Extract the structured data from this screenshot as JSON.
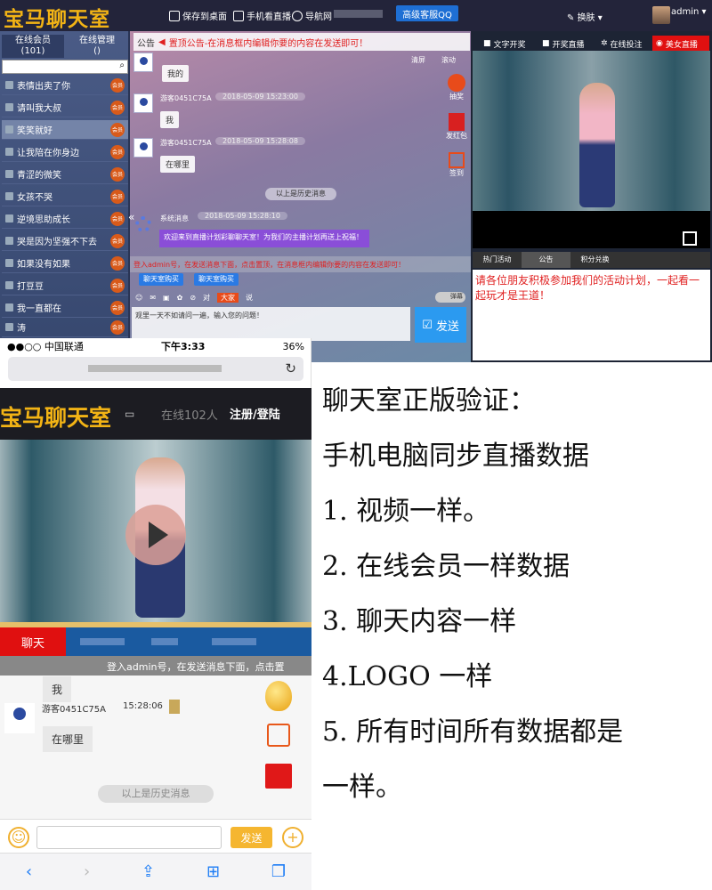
{
  "desktop": {
    "logo": "宝马聊天室",
    "nav": [
      "保存到桌面",
      "手机看直播",
      "导航网"
    ],
    "qq_button": "高级客服QQ",
    "skin": "换肤",
    "admin": "admin",
    "left_tabs": [
      {
        "label": "在线会员",
        "count": "(101)"
      },
      {
        "label": "在线管理",
        "count": "()"
      }
    ],
    "members": [
      "表情出卖了你",
      "请叫我大叔",
      "笑笑就好",
      "让我陪在你身边",
      "青涩的微笑",
      "女孩不哭",
      "逆境思助成长",
      "哭是因为坚强不下去",
      "如果没有如果",
      "打豆豆",
      "我一直都在",
      "涛"
    ],
    "member_badge": "会员",
    "notice_label": "公告",
    "notice": "置顶公告-在消息框内编辑你要的内容在发送即可！",
    "chat_tools": [
      "清屏",
      "滚动"
    ],
    "side_buttons": [
      "抽奖",
      "发红包",
      "签到"
    ],
    "messages": [
      {
        "name": "游客0451C75A",
        "time": "2018-05-09 15:23:00",
        "text": "我的"
      },
      {
        "name": "游客0451C75A",
        "time": "2018-05-09 15:23:00",
        "text": "我"
      },
      {
        "name": "游客0451C75A",
        "time": "2018-05-09 15:28:08",
        "text": "在哪里"
      }
    ],
    "history": "以上是历史消息",
    "system_name": "系统消息",
    "system_time": "2018-05-09 15:28:10",
    "system_text": "欢迎来到直播计划彩聊聊天室！为我们的主播计划再送上祝福！",
    "red_strip": "登入admin号，在发送消息下面，点击置顶，在消息框内编辑你要的内容在发送即可！",
    "qq_chips": [
      "聊天室购买",
      "聊天室购买"
    ],
    "toolbar_to": "对",
    "toolbar_everyone": "大家",
    "toolbar_say": "说",
    "danmu": "弹幕",
    "input_placeholder": "观里一天不如请问一遍，输入您的问题！",
    "send": "发送",
    "right_tabs": [
      "文字开奖",
      "开奖直播",
      "在线投注",
      "美女直播"
    ],
    "info_tabs": [
      "热门活动",
      "公告",
      "积分兑换"
    ],
    "right_notice": "请各位朋友积极参加我们的活动计划，一起看一起玩才是王道！"
  },
  "phone": {
    "carrier": "●●○○ 中国联通",
    "time": "下午3:33",
    "battery": "36%",
    "logo": "宝马聊天室",
    "online": "在线102人",
    "register": "注册/登陆",
    "tab_chat": "聊天",
    "notice": "登入admin号，在发送消息下面，点击置",
    "msg1": "我",
    "name": "游客0451C75A",
    "time2": "15:28:06",
    "msg2": "在哪里",
    "history": "以上是历史消息",
    "send": "发送"
  },
  "description": [
    "聊天室正版验证：",
    "手机电脑同步直播数据",
    "1. 视频一样。",
    "2. 在线会员一样数据",
    "3. 聊天内容一样",
    "4.LOGO 一样",
    "5. 所有时间所有数据都是",
    "一样。"
  ]
}
